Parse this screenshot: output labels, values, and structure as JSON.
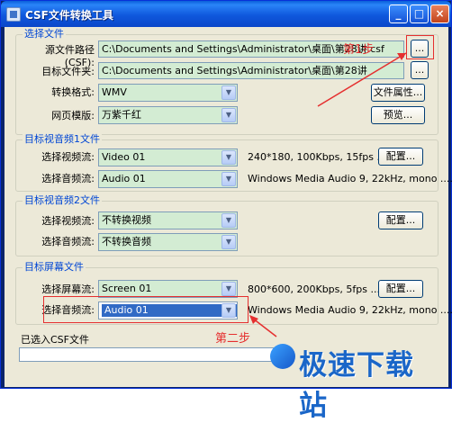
{
  "window": {
    "title": "CSF文件转换工具",
    "buttons": {
      "minimize": "_",
      "maximize": "□",
      "close": "×"
    }
  },
  "select_file": {
    "group_title": "选择文件",
    "source_label": "源文件路径(CSF):",
    "source_value": "C:\\Documents and Settings\\Administrator\\桌面\\第28讲.csf",
    "browse_label": "...",
    "target_label": "目标文件夹:",
    "target_value": "C:\\Documents and Settings\\Administrator\\桌面\\第28讲",
    "target_browse_label": "...",
    "format_label": "转换格式:",
    "format_value": "WMV",
    "file_props_label": "文件属性...",
    "template_label": "网页模版:",
    "template_value": "万紫千红",
    "preview_label": "预览..."
  },
  "av1": {
    "group_title": "目标视音频1文件",
    "video_label": "选择视频流:",
    "video_value": "Video 01",
    "video_info": "240*180, 100Kbps, 15fps ......",
    "audio_label": "选择音频流:",
    "audio_value": "Audio 01",
    "audio_info": "Windows Media Audio 9, 22kHz, mono ......",
    "config_label": "配置..."
  },
  "av2": {
    "group_title": "目标视音频2文件",
    "video_label": "选择视频流:",
    "video_value": "不转换视频",
    "audio_label": "选择音频流:",
    "audio_value": "不转换音频",
    "config_label": "配置..."
  },
  "screen": {
    "group_title": "目标屏幕文件",
    "screen_label": "选择屏幕流:",
    "screen_value": "Screen 01",
    "screen_info": "800*600, 200Kbps, 5fps ......",
    "audio_label": "选择音频流:",
    "audio_value": "Audio 01",
    "audio_info": "Windows Media Audio 9, 22kHz, mono ......",
    "config_label": "配置..."
  },
  "status": {
    "label": "已选入CSF文件"
  },
  "annotations": {
    "step1": "第1步",
    "step2": "第二步"
  },
  "watermark": {
    "text": "极速下载站"
  },
  "colors": {
    "annotation_red": "#e52f2f",
    "group_title_blue": "#0046d5",
    "field_green": "#d3ecd3"
  }
}
